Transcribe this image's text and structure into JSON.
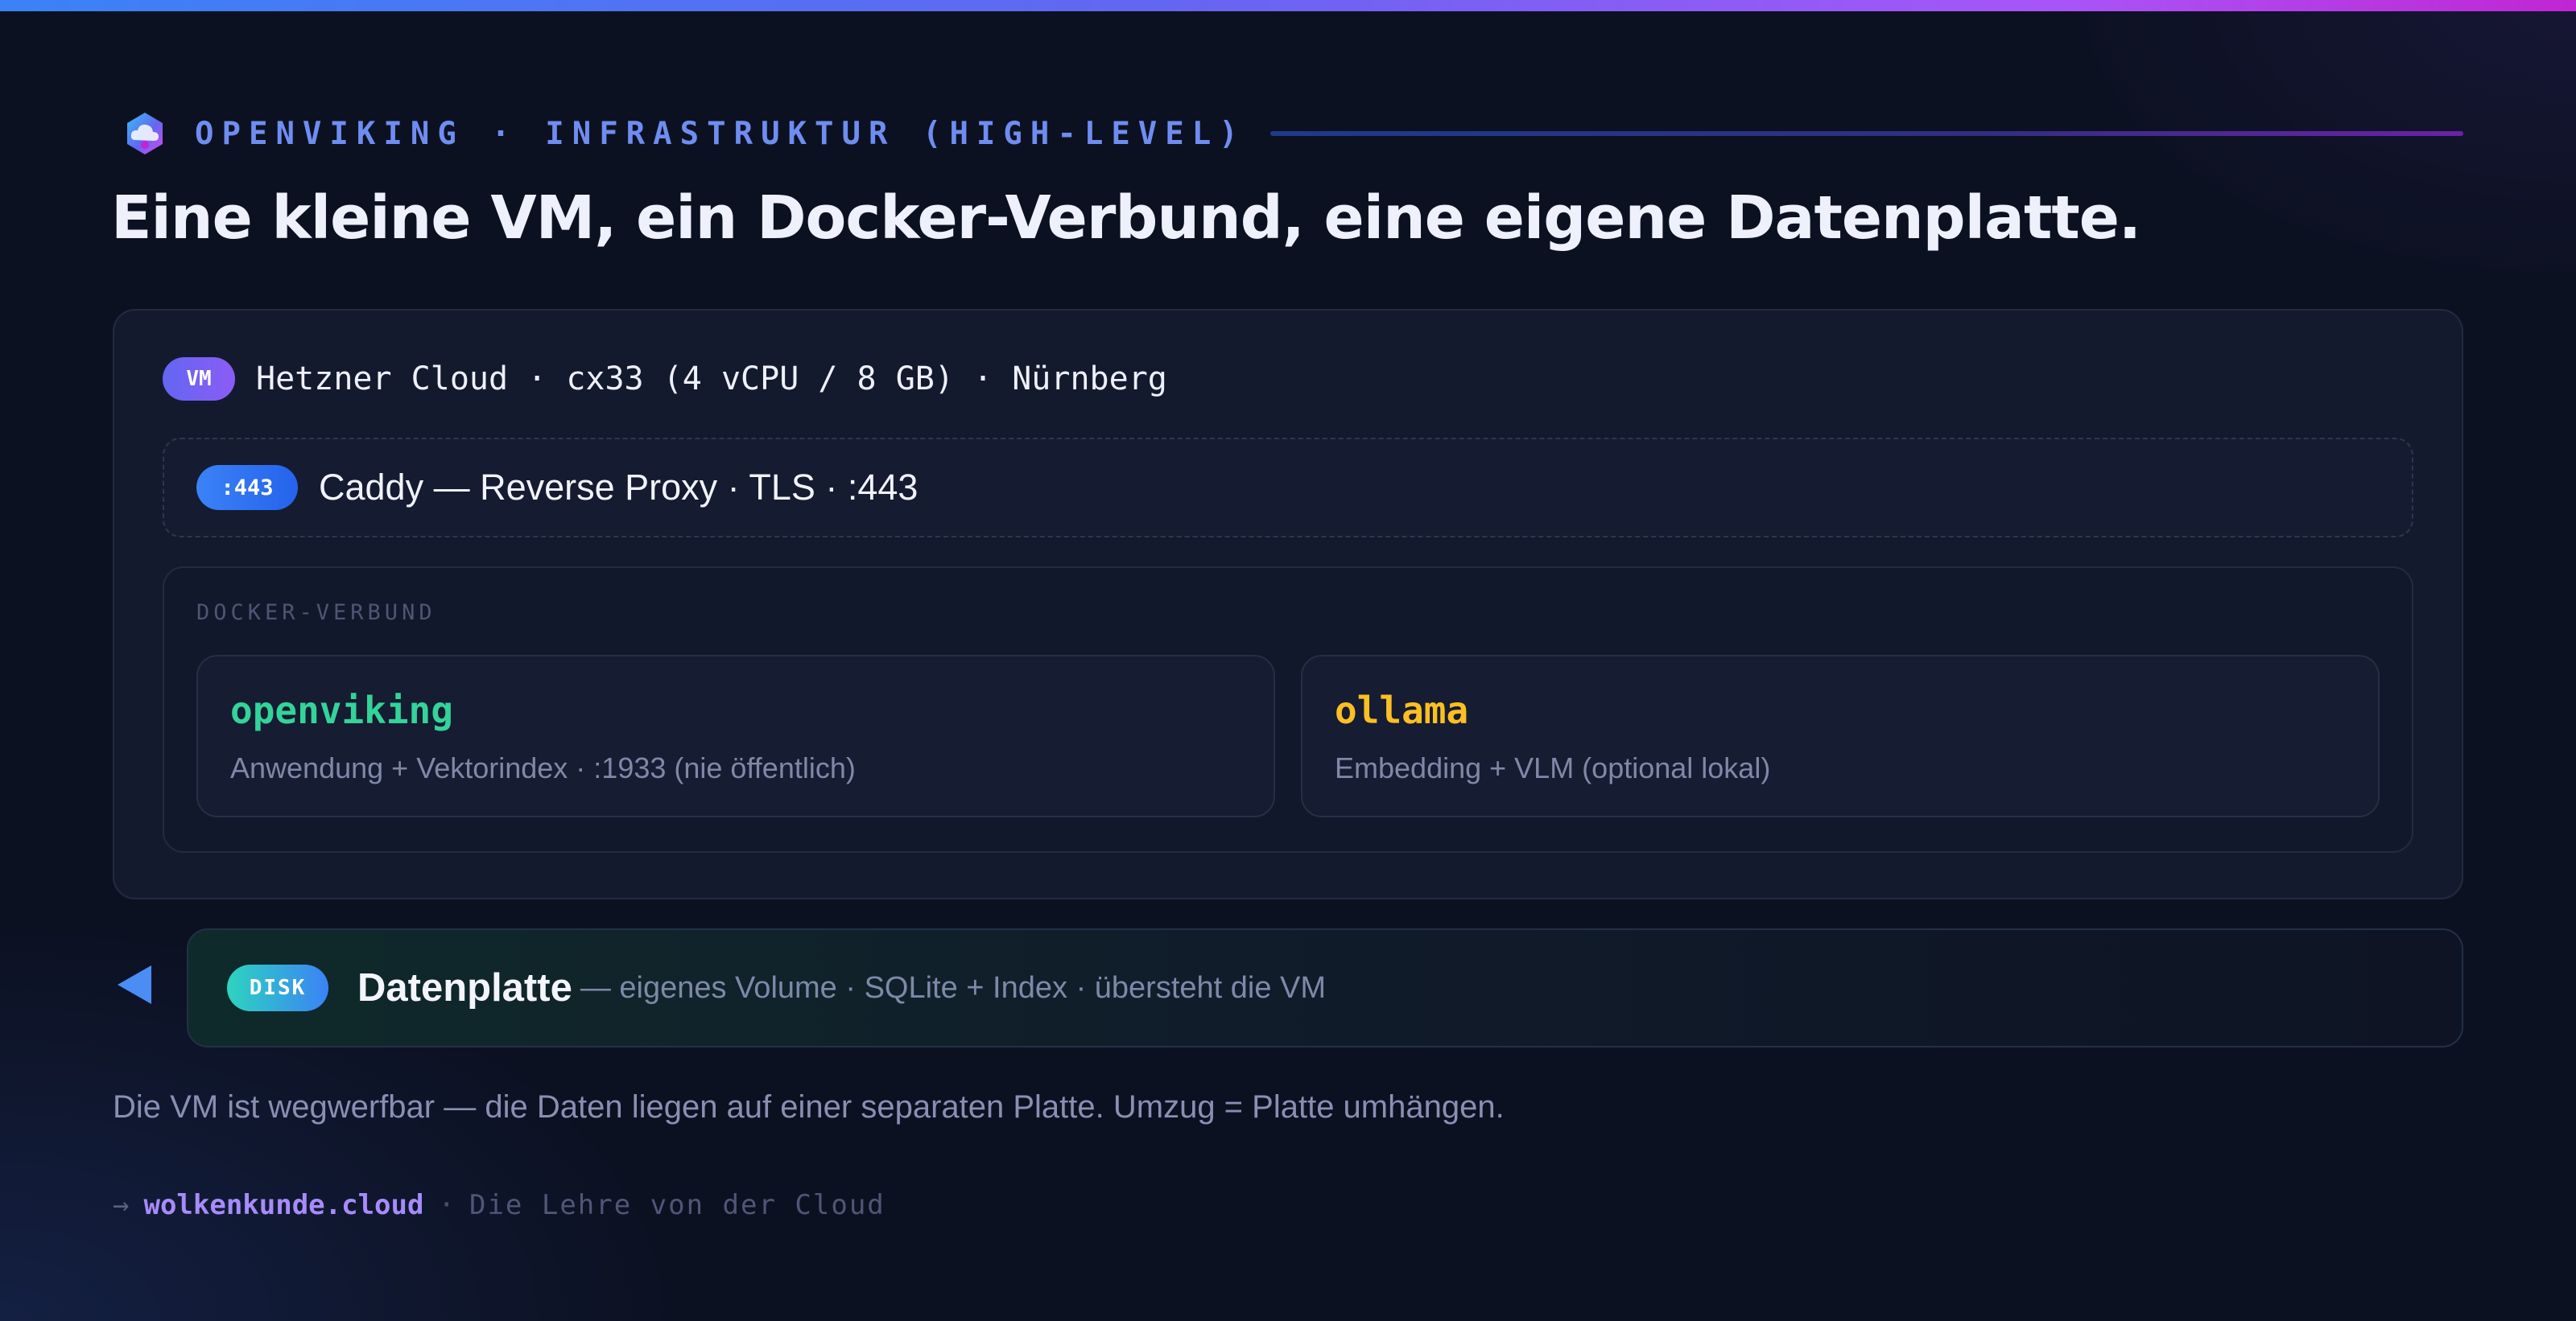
{
  "header": {
    "eyebrow": "OPENVIKING · INFRASTRUKTUR (HIGH-LEVEL)",
    "title": "Eine kleine VM, ein Docker-Verbund, eine eigene Datenplatte."
  },
  "vm": {
    "badge": "VM",
    "label": "Hetzner Cloud · cx33 (4 vCPU / 8 GB) · Nürnberg"
  },
  "proxy": {
    "badge": ":443",
    "label": "Caddy — Reverse Proxy · TLS · :443"
  },
  "docker": {
    "label": "DOCKER-VERBUND",
    "services": [
      {
        "name": "openviking",
        "description": "Anwendung + Vektorindex · :1933 (nie öffentlich)",
        "color": "#34d399"
      },
      {
        "name": "ollama",
        "description": "Embedding + VLM (optional lokal)",
        "color": "#fbbf24"
      }
    ]
  },
  "disk": {
    "badge": "DISK",
    "name": "Datenplatte",
    "description": "— eigenes Volume · SQLite + Index · übersteht die VM"
  },
  "footnote": "Die VM ist wegwerfbar — die Daten liegen auf einer separaten Platte. Umzug = Platte umhängen.",
  "footer": {
    "arrow": "→",
    "url": "wolkenkunde.cloud",
    "separator": "·",
    "tagline": "Die Lehre von der Cloud"
  },
  "colors": {
    "accent_top": "#3b82f6",
    "accent_purple": "#a855f7",
    "background": "#0c1122"
  }
}
